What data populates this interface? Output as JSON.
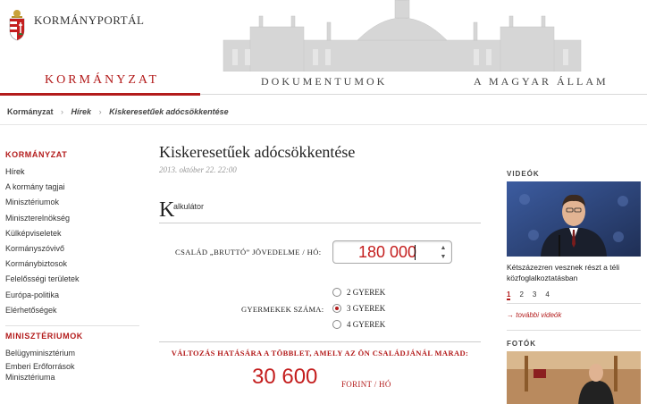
{
  "site": {
    "title": "Kormányportál"
  },
  "nav": {
    "items": [
      {
        "label": "KORMÁNYZAT"
      },
      {
        "label": "DOKUMENTUMOK"
      },
      {
        "label": "A MAGYAR ÁLLAM"
      }
    ]
  },
  "breadcrumb": {
    "items": [
      "Kormányzat",
      "Hírek",
      "Kiskeresetűek adócsökkentése"
    ]
  },
  "sidebar": {
    "section1_title": "KORMÁNYZAT",
    "section1_items": [
      "Hírek",
      "A kormány tagjai",
      "Minisztériumok",
      "Miniszterelnökség",
      "Külképviseletek",
      "Kormányszóvivő",
      "Kormánybiztosok",
      "Felelősségi területek",
      "Európa-politika",
      "Elérhetőségek"
    ],
    "section2_title": "MINISZTÉRIUMOK",
    "section2_items": [
      "Belügyminisztérium",
      "Emberi Erőforrások",
      "Minisztériuma"
    ]
  },
  "article": {
    "title": "Kiskeresetűek adócsökkentése",
    "date": "2013. október 22. 22:00",
    "calc_initial": "K",
    "calc_rest": "alkulátor"
  },
  "calculator": {
    "income_label": "Család „Bruttó” jövedelme / hó:",
    "income_value": "180 000",
    "children_label": "Gyermekek száma:",
    "children_options": [
      "2 gyerek",
      "3 gyerek",
      "4 gyerek"
    ],
    "children_selected": "3 gyerek",
    "result_label": "Változás hatására a többlet, amely az Ön családjánál marad:",
    "result_value": "30 600",
    "result_unit": "Forint / Hó"
  },
  "right": {
    "videos_title": "VIDEÓK",
    "video_caption": "Kétszázezren vesznek részt a téli közfoglalkoztatásban",
    "pages": [
      "1",
      "2",
      "3",
      "4"
    ],
    "active_page": "1",
    "more_videos": "→ további videók",
    "photos_title": "FOTÓK"
  },
  "colors": {
    "accent": "#b31b1b",
    "value_red": "#c41e1e"
  }
}
